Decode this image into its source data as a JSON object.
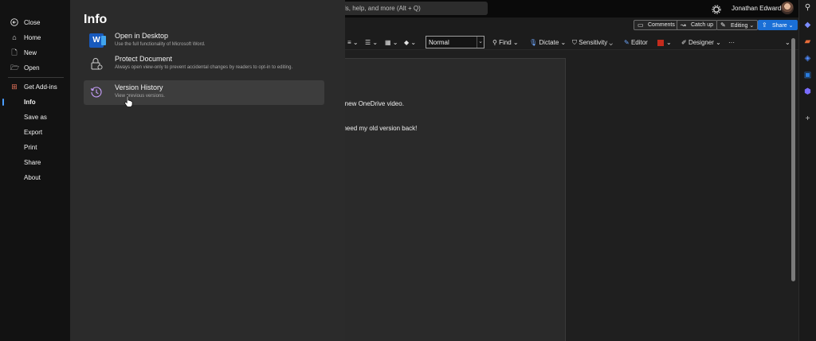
{
  "topbar": {
    "search_text": "ls, help, and more (Alt + Q)",
    "user_name": "Jonathan Edwards"
  },
  "commands": {
    "comments": "Comments",
    "catch_up": "Catch up",
    "editing": "Editing",
    "share": "Share"
  },
  "ribbon": {
    "style_value": "Normal",
    "find": "Find",
    "dictate": "Dictate",
    "sensitivity": "Sensitivity",
    "editor": "Editor",
    "designer": "Designer",
    "more": "···"
  },
  "document": {
    "line1": "e new OneDrive video.",
    "line2": "I need my old version back!"
  },
  "backstage": {
    "nav": {
      "close": "Close",
      "home": "Home",
      "new": "New",
      "open": "Open",
      "get_add_ins": "Get Add-ins",
      "info": "Info",
      "save_as": "Save as",
      "export": "Export",
      "print": "Print",
      "share": "Share",
      "about": "About"
    },
    "info": {
      "title": "Info",
      "items": [
        {
          "title": "Open in Desktop",
          "desc": "Use the full functionality of Microsoft Word."
        },
        {
          "title": "Protect Document",
          "desc": "Always open view-only to prevent accidental changes by readers to opt-in to editing."
        },
        {
          "title": "Version History",
          "desc": "View previous versions."
        }
      ]
    }
  },
  "colors": {
    "accent": "#4a9eff",
    "share_button": "#1a6fd6",
    "word_blue": "#185abd"
  }
}
